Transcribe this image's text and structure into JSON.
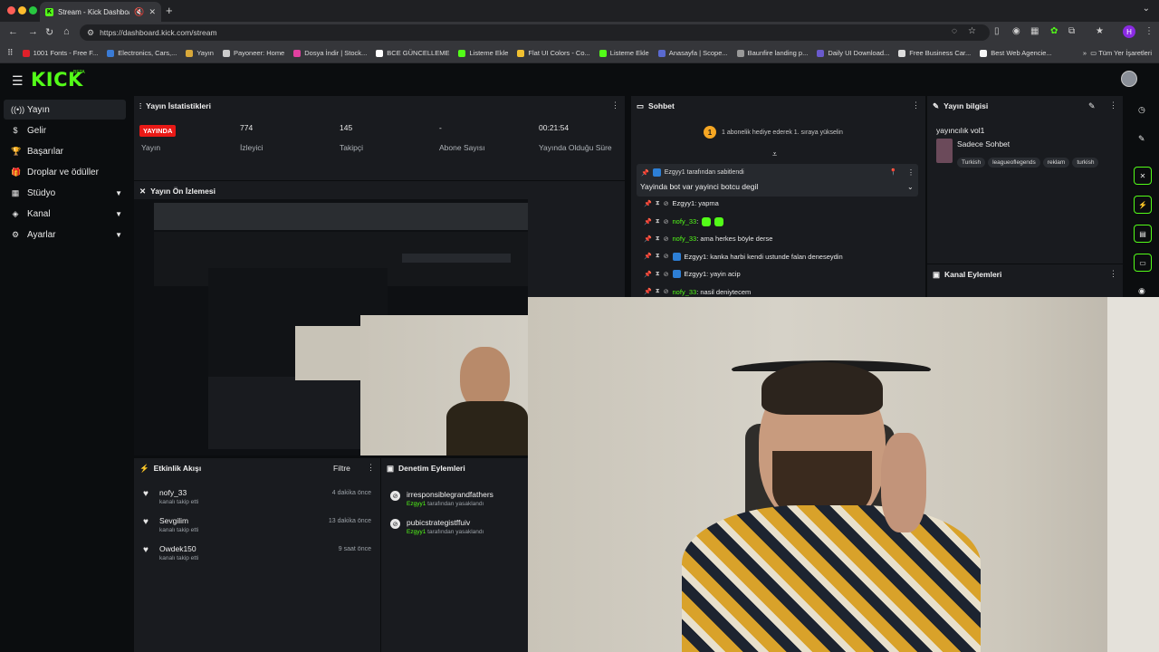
{
  "browser": {
    "tab_title": "Stream - Kick Dashboard",
    "url": "https://dashboard.kick.com/stream",
    "profile_initial": "H",
    "bookmarks": [
      {
        "label": "1001 Fonts - Free F...",
        "color": "#e0202a"
      },
      {
        "label": "Electronics, Cars,...",
        "color": "#3a7bd5"
      },
      {
        "label": "Yayın",
        "color": "#d8a83a"
      },
      {
        "label": "Payoneer: Home",
        "color": "#cccccc"
      },
      {
        "label": "Dosya İndir | Stock...",
        "color": "#e040a0"
      },
      {
        "label": "BCE GÜNCELLEME",
        "color": "#ffffff"
      },
      {
        "label": "Listeme Ekle",
        "color": "#53fc18"
      },
      {
        "label": "Flat UI Colors - Co...",
        "color": "#f0c030"
      },
      {
        "label": "Listeme Ekle",
        "color": "#53fc18"
      },
      {
        "label": "Anasayfa | Scope...",
        "color": "#5a6ad0"
      },
      {
        "label": "Baunfire landing p...",
        "color": "#999999"
      },
      {
        "label": "Daily UI Download...",
        "color": "#6a5acd"
      },
      {
        "label": "Free Business Car...",
        "color": "#dddddd"
      },
      {
        "label": "Best Web Agencie...",
        "color": "#f5f5f5"
      }
    ],
    "other_bookmarks": "Tüm Yer İşaretleri"
  },
  "kick": {
    "logo": "KICK",
    "beta": "BETA"
  },
  "sidebar": {
    "items": [
      {
        "label": "Yayın",
        "icon": "broadcast-icon",
        "glyph": "((•))",
        "chevron": false
      },
      {
        "label": "Gelir",
        "icon": "dollar-icon",
        "glyph": "$",
        "chevron": false
      },
      {
        "label": "Başarılar",
        "icon": "trophy-icon",
        "glyph": "🏆",
        "chevron": false
      },
      {
        "label": "Droplar ve ödüller",
        "icon": "gift-icon",
        "glyph": "🎁",
        "chevron": false
      },
      {
        "label": "Stüdyo",
        "icon": "grid-icon",
        "glyph": "▦",
        "chevron": true
      },
      {
        "label": "Kanal",
        "icon": "layers-icon",
        "glyph": "◈",
        "chevron": true
      },
      {
        "label": "Ayarlar",
        "icon": "gear-icon",
        "glyph": "⚙",
        "chevron": true
      }
    ]
  },
  "stats": {
    "title": "Yayın İstatistikleri",
    "live_badge": "YAYINDA",
    "live_label": "Yayın",
    "viewers_value": "774",
    "viewers_label": "İzleyici",
    "followers_value": "145",
    "followers_label": "Takipçi",
    "subs_value": "-",
    "subs_label": "Abone Sayısı",
    "uptime_value": "00:21:54",
    "uptime_label": "Yayında Olduğu Süre"
  },
  "preview": {
    "title": "Yayın Ön İzlemesi"
  },
  "feed": {
    "title": "Etkinlik Akışı",
    "filter": "Filtre",
    "items": [
      {
        "name": "nofy_33",
        "sub": "kanalı takip etti",
        "time": "4 dakika önce"
      },
      {
        "name": "Sevgilim",
        "sub": "kanalı takip etti",
        "time": "13 dakika önce"
      },
      {
        "name": "Owdek150",
        "sub": "kanalı takip etti",
        "time": "9 saat önce"
      }
    ]
  },
  "moderation": {
    "title": "Denetim Eylemleri",
    "items": [
      {
        "name": "irresponsiblegrandfathers",
        "by": "Ezgyy1",
        "sub": " tarafından yasaklandı"
      },
      {
        "name": "pubicstrategistffuiv",
        "by": "Ezgyy1",
        "sub": " tarafından yasaklandı"
      }
    ]
  },
  "chat": {
    "title": "Sohbet",
    "gift_notice": "1 abonelik hediye ederek 1. sıraya yükselin",
    "gift_badge": "1",
    "pinned_by": "Ezgyy1 tarafından sabitlendi",
    "pinned_message": "Yayinda bot var yayinci botcu degil",
    "messages": [
      {
        "user": "Ezgyy1",
        "text": ": yapma",
        "color": "white",
        "badge": false
      },
      {
        "user": "nofy_33",
        "text": ":",
        "color": "green",
        "badge": false,
        "emotes": true
      },
      {
        "user": "nofy_33",
        "text": ": ama herkes böyle derse",
        "color": "green",
        "badge": false
      },
      {
        "user": "Ezgyy1",
        "text": ": kanka harbi kendi ustunde falan deneseydin",
        "color": "white",
        "badge": true
      },
      {
        "user": "Ezgyy1",
        "text": ": yayin acip",
        "color": "white",
        "badge": true
      },
      {
        "user": "nofy_33",
        "text": ": nasil deniytecem",
        "color": "green",
        "badge": false
      }
    ]
  },
  "stream_info": {
    "title": "Yayın bilgisi",
    "stream_title": "yayıncılık vol1",
    "category": "Sadece Sohbet",
    "tags": [
      "Turkish",
      "leagueoflegends",
      "reklam",
      "turkish"
    ]
  },
  "channel_actions": {
    "title": "Kanal Eylemleri"
  }
}
